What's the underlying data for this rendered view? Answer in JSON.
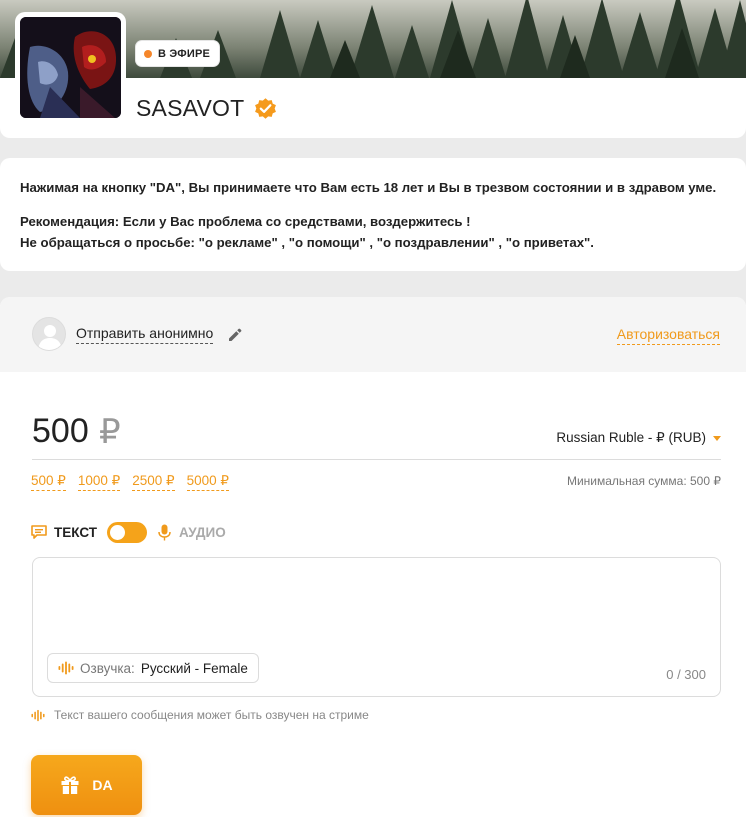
{
  "profile": {
    "live_badge": "В ЭФИРЕ",
    "name": "SASAVOT",
    "verified_icon": "verified-badge-icon",
    "avatar_icon": "streamer-avatar"
  },
  "notice": {
    "line1": "Нажимая на кнопку \"DA\", Вы принимаете что Вам есть 18 лет и Вы в трезвом состоянии и в здравом уме.",
    "line2": "Рекомендация: Если у Вас проблема со средствами, воздержитесь !",
    "line3": "Не обращаться о просьбе: \"о рекламе\" , \"о помощи\" , \"о поздравлении\" , \"о приветах\"."
  },
  "donate": {
    "anon_label": "Отправить анонимно",
    "auth_label": "Авторизоваться",
    "amount": "500",
    "currency_sign": "₽",
    "currency_select": "Russian Ruble - ₽ (RUB)",
    "presets": [
      "500 ₽",
      "1000 ₽",
      "2500 ₽",
      "5000 ₽"
    ],
    "min_amount": "Минимальная сумма: 500 ₽",
    "mode_text": "ТЕКСТ",
    "mode_audio": "АУДИО",
    "toggle_on": true,
    "message_value": "",
    "voice_label": "Озвучка:",
    "voice_value": "Русский - Female",
    "char_count": "0 / 300",
    "hint": "Текст вашего сообщения может быть озвучен на стриме",
    "submit_label": "DA"
  },
  "colors": {
    "accent": "#f09a1c",
    "live_dot": "#f5862a",
    "background": "#ebebeb"
  }
}
